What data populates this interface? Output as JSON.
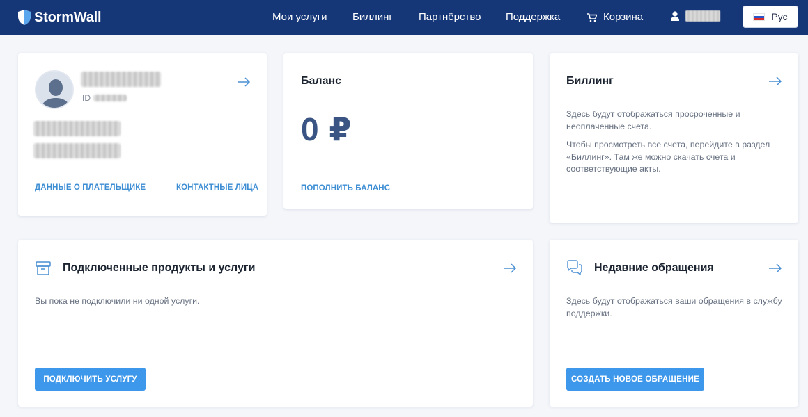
{
  "header": {
    "logo_text": "StormWall",
    "nav": [
      {
        "label": "Мои услуги"
      },
      {
        "label": "Биллинг"
      },
      {
        "label": "Партнёрство"
      },
      {
        "label": "Поддержка"
      }
    ],
    "cart_label": "Корзина",
    "language": "Рус",
    "icons": {
      "logo": "shield-icon",
      "cart": "cart-icon",
      "user": "user-icon",
      "flag": "russia-flag-icon"
    }
  },
  "profile": {
    "id_label": "ID",
    "payer_link": "ДАННЫЕ О ПЛАТЕЛЬЩИКЕ",
    "contacts_link": "КОНТАКТНЫЕ ЛИЦА"
  },
  "balance": {
    "title": "Баланс",
    "amount": "0 ₽",
    "topup_link": "ПОПОЛНИТЬ БАЛАНС"
  },
  "billing": {
    "title": "Биллинг",
    "text1": "Здесь будут отображаться просроченные и неоплаченные счета.",
    "text2": "Чтобы просмотреть все счета, перейдите в раздел «Биллинг». Там же можно скачать счета и соответствующие акты."
  },
  "services": {
    "title": "Подключенные продукты и услуги",
    "empty_text": "Вы пока не подключили ни одной услуги.",
    "button": "ПОДКЛЮЧИТЬ УСЛУГУ"
  },
  "tickets": {
    "title": "Недавние обращения",
    "text": "Здесь будут отображаться ваши обращения в службу поддержки.",
    "button": "СОЗДАТЬ НОВОЕ ОБРАЩЕНИЕ"
  },
  "colors": {
    "header_bg": "#153777",
    "accent": "#3d97ea",
    "link": "#3e8ed4",
    "balance": "#3a5484"
  }
}
